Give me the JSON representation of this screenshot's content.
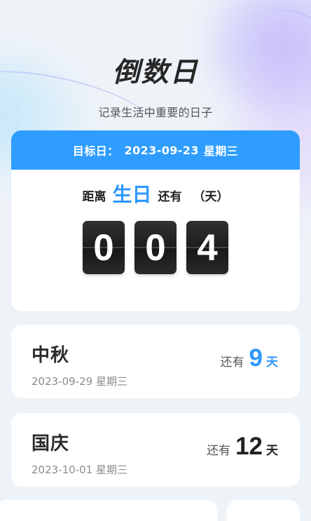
{
  "header": {
    "title": "倒数日",
    "subtitle": "记录生活中重要的日子"
  },
  "main_card": {
    "target_label": "目标日：",
    "target_date": "2023-09-23",
    "target_weekday": "星期三",
    "prefix": "距离",
    "event_name": "生日",
    "suffix": "还有",
    "unit": "（天）",
    "digits": [
      "0",
      "0",
      "4"
    ]
  },
  "events": [
    {
      "name": "中秋",
      "date": "2023-09-29 星期三",
      "remain_prefix": "还有",
      "days": "9",
      "unit": "天"
    },
    {
      "name": "国庆",
      "date": "2023-10-01 星期三",
      "remain_prefix": "还有",
      "days": "12",
      "unit": "天"
    }
  ],
  "colors": {
    "accent": "#2f9dff",
    "digit_bg": "#1f1f1f",
    "background": "#eef3f8"
  }
}
